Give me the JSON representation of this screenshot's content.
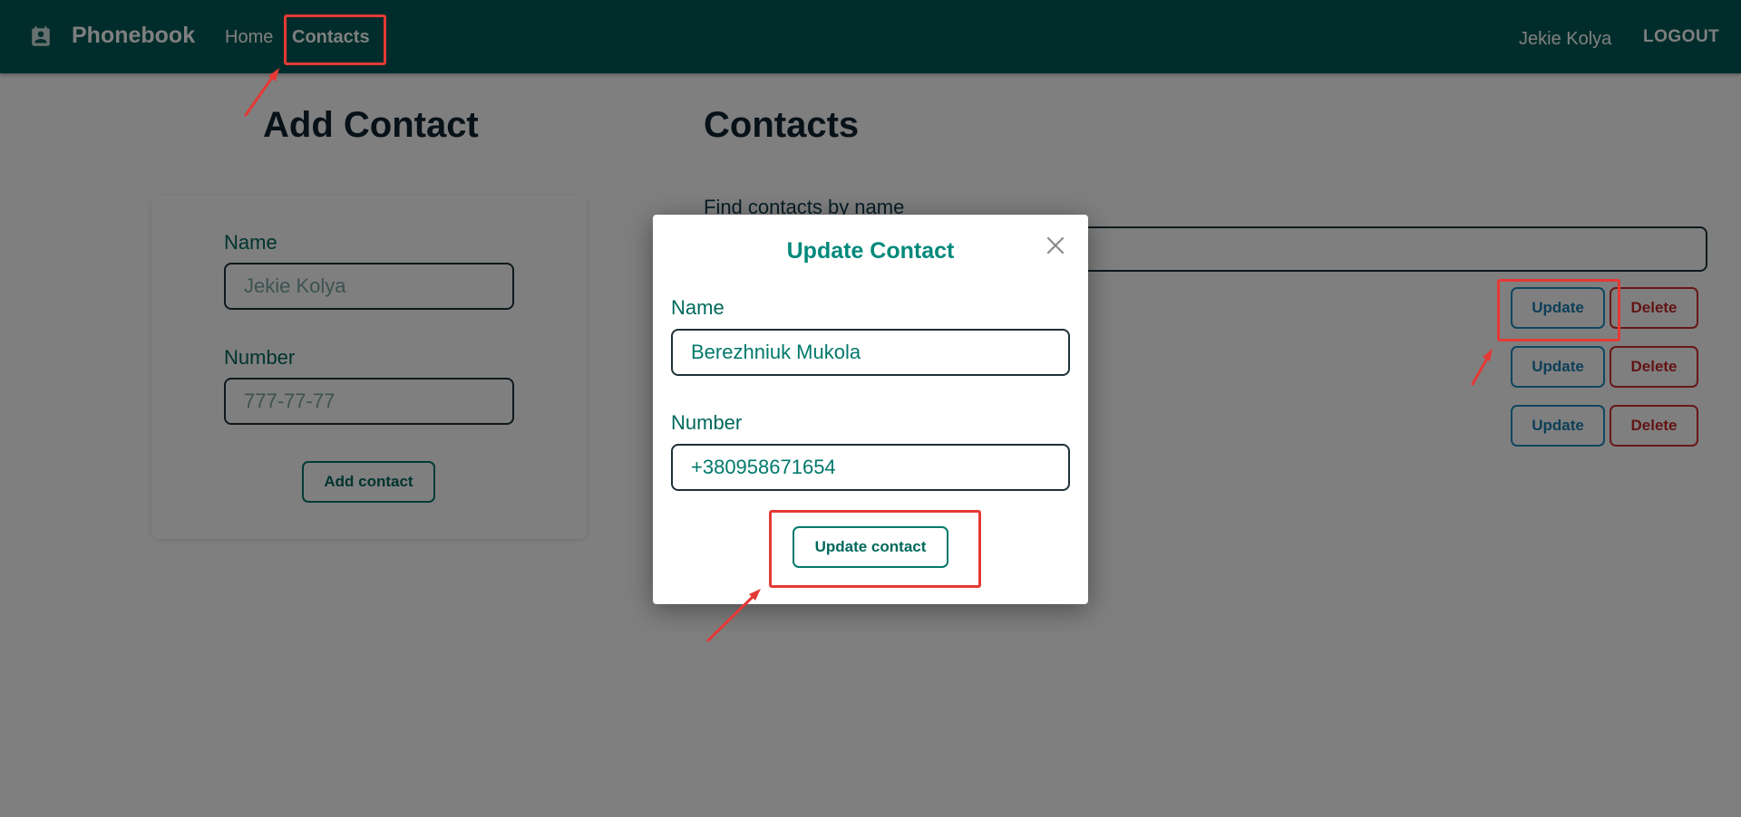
{
  "appbar": {
    "brand": "Phonebook",
    "nav": {
      "home": "Home",
      "contacts": "Contacts"
    },
    "user_name": "Jekie Kolya",
    "logout": "LOGOUT",
    "icons": {
      "brand": "contact-book-icon"
    },
    "bg_color": "#005b56"
  },
  "add_contact": {
    "title": "Add Contact",
    "name_label": "Name",
    "name_placeholder": "Jekie Kolya",
    "number_label": "Number",
    "number_placeholder": "777-77-77",
    "submit_label": "Add contact"
  },
  "contacts": {
    "title": "Contacts",
    "filter_label": "Find contacts by name",
    "rows": [
      {
        "update_label": "Update",
        "delete_label": "Delete"
      },
      {
        "update_label": "Update",
        "delete_label": "Delete"
      },
      {
        "update_label": "Update",
        "delete_label": "Delete"
      }
    ]
  },
  "modal": {
    "title": "Update Contact",
    "name_label": "Name",
    "name_value": "Berezhniuk Mukola",
    "number_label": "Number",
    "number_value": "+380958671654",
    "submit_label": "Update contact",
    "icons": {
      "close": "close-icon"
    }
  },
  "colors": {
    "accent": "#00897b",
    "update": "#1e8fc0",
    "delete": "#d32f2f",
    "annotation": "#e53935"
  }
}
